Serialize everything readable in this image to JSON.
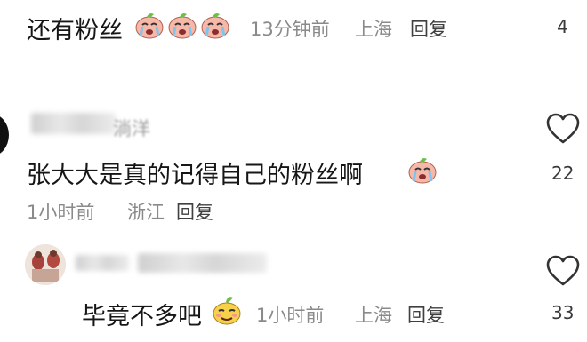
{
  "comment1": {
    "text": "还有粉丝",
    "emoji_icon": "crying-face-emoji",
    "time": "13分钟前",
    "location": "上海",
    "reply_label": "回复",
    "likes": "4"
  },
  "comment2": {
    "username_partial": "淌洋",
    "text": "张大大是真的记得自己的粉丝啊",
    "emoji_icon": "crying-face-emoji",
    "time": "1小时前",
    "location": "浙江",
    "reply_label": "回复",
    "likes": "22"
  },
  "reply1": {
    "text": "毕竟不多吧",
    "emoji_icon": "smirk-face-emoji",
    "time": "1小时前",
    "location": "上海",
    "reply_label": "回复",
    "likes": "33"
  },
  "colors": {
    "text": "#161616",
    "meta": "#8a8a8a",
    "emoji_body": "#f6b8a8",
    "emoji_leaf": "#6cc04a",
    "emoji_yellow": "#f7d14a"
  }
}
